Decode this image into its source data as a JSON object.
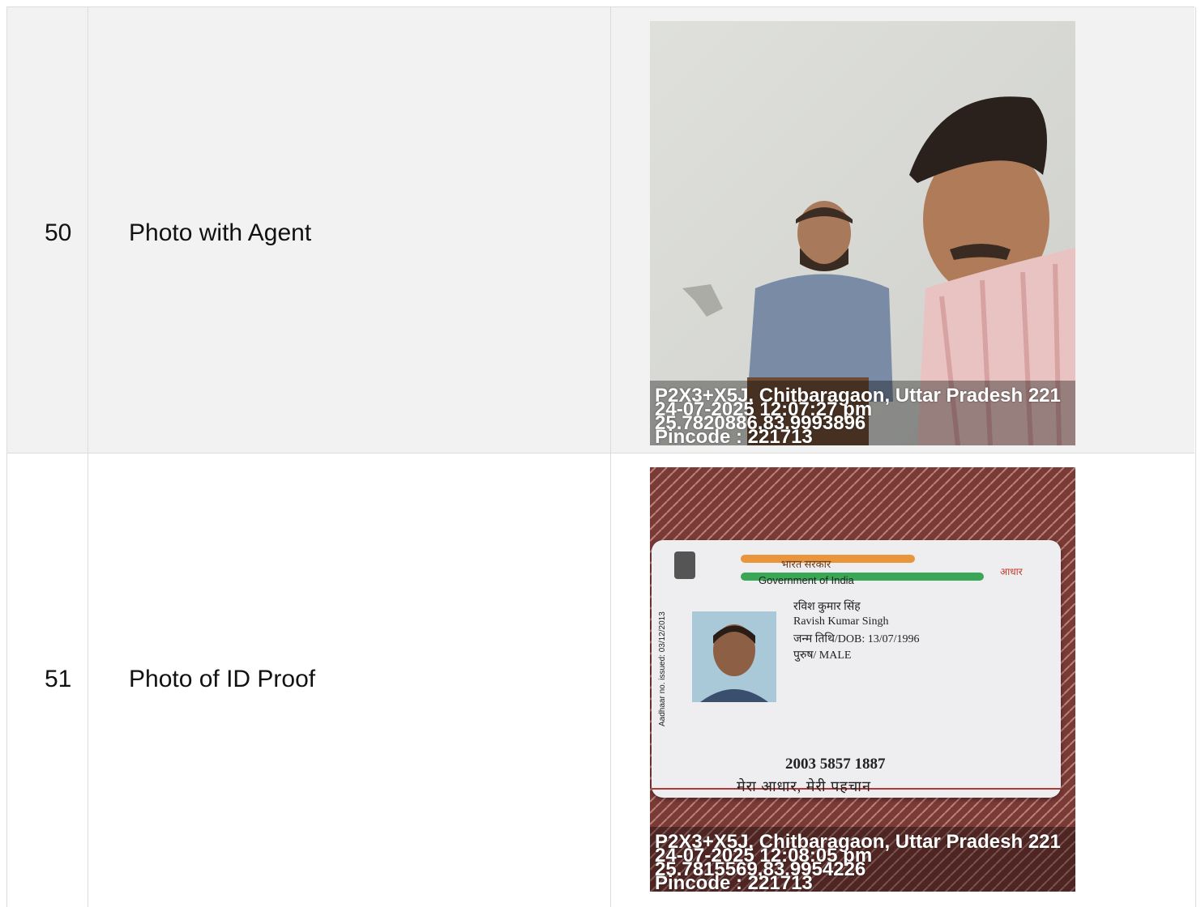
{
  "rows": [
    {
      "number": "50",
      "label": "Photo with Agent",
      "photo": {
        "stamp": [
          "P2X3+X5J, Chitbaragaon, Uttar Pradesh 221",
          "24-07-2025 12:07:27 pm",
          "25.7820886,83.9993896",
          "Pincode : 221713"
        ]
      }
    },
    {
      "number": "51",
      "label": "Photo of ID Proof",
      "photo": {
        "card": {
          "hindi_header": "भारत सरकार",
          "gov": "Government of India",
          "name_hi": "रविश कुमार सिंह",
          "name_en": "Ravish Kumar Singh",
          "dob": "जन्म तिथि/DOB: 13/07/1996",
          "gender": "पुरुष/ MALE",
          "number": "2003 5857 1887",
          "tagline": "मेरा आधार, मेरी पहचान",
          "issued": "Aadhaar no. issued: 03/12/2013",
          "logo": "आधार"
        },
        "stamp": [
          "P2X3+X5J, Chitbaragaon, Uttar Pradesh 221",
          "24-07-2025 12:08:05 pm",
          "25.7815569,83.9954226",
          "Pincode : 221713"
        ]
      }
    }
  ]
}
